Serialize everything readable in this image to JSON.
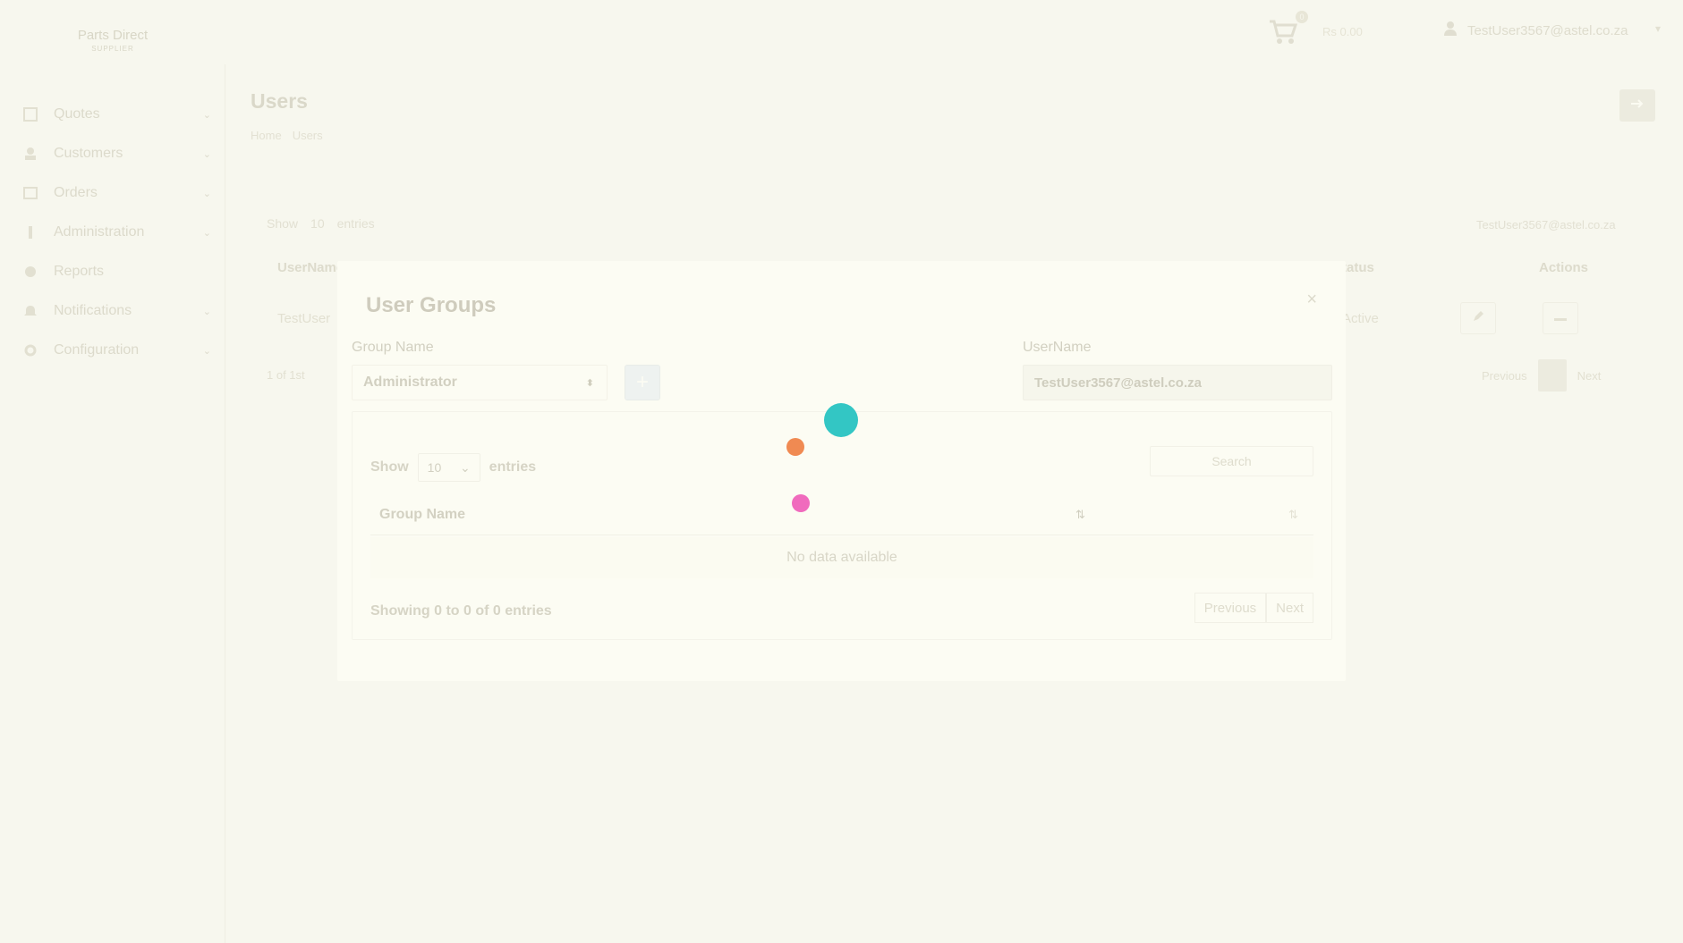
{
  "header": {
    "logo_text": "Parts Direct",
    "logo_sub": "SUPPLIER",
    "cart_count": "0",
    "cart_label": "Rs 0.00",
    "user_email": "TestUser3567@astel.co.za"
  },
  "sidebar": {
    "items": [
      {
        "label": "Quotes",
        "icon": "quote-icon",
        "has_children": true
      },
      {
        "label": "Customers",
        "icon": "customers-icon",
        "has_children": true
      },
      {
        "label": "Orders",
        "icon": "orders-icon",
        "has_children": true
      },
      {
        "label": "Administration",
        "icon": "administration-icon",
        "has_children": true
      },
      {
        "label": "Reports",
        "icon": "reports-icon",
        "has_children": false
      },
      {
        "label": "Notifications",
        "icon": "bell-icon",
        "has_children": true
      },
      {
        "label": "Configuration",
        "icon": "gear-icon",
        "has_children": true
      }
    ]
  },
  "page": {
    "title": "Users",
    "breadcrumb": [
      "Home",
      "Users"
    ],
    "show_label": "Show",
    "show_value": "10",
    "entries_label": "entries",
    "filter_value": "TestUser3567@astel.co.za",
    "columns": [
      "UserName",
      "Status",
      "Actions"
    ],
    "row": {
      "username": "TestUser",
      "status": "Active"
    },
    "info": "1 of 1st",
    "pager": {
      "previous": "Previous",
      "current": "1",
      "next": "Next"
    }
  },
  "modal": {
    "title": "User Groups",
    "close_symbol": "×",
    "group_name_label": "Group Name",
    "group_select_value": "Administrator",
    "username_label": "UserName",
    "username_value": "TestUser3567@astel.co.za",
    "table": {
      "show_label": "Show",
      "length_value": "10",
      "entries_label": "entries",
      "search_placeholder": "Search",
      "column_header": "Group Name",
      "empty_text": "No data available",
      "info_text": "Showing 0 to 0 of 0 entries",
      "previous_label": "Previous",
      "next_label": "Next"
    }
  },
  "loader": {
    "dot_colors": [
      "#33c6c4",
      "#f08a52",
      "#f06bbd"
    ]
  },
  "colors": {
    "background": "#f7f7ee",
    "modal_background": "#fcfcf3"
  }
}
